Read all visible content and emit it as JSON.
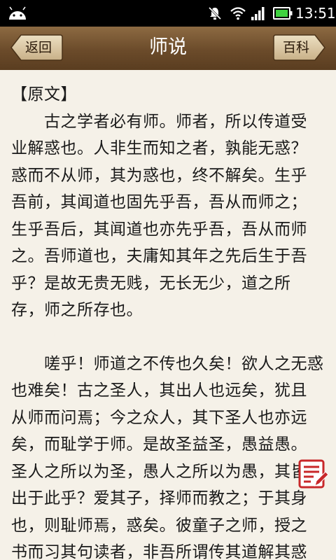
{
  "status_bar": {
    "time": "13:51"
  },
  "header": {
    "back_label": "返回",
    "title": "师说",
    "wiki_label": "百科"
  },
  "content": {
    "section_heading": "【原文】",
    "paragraph_1": [
      "　　古之学者必有师。师者，所以传道受",
      "业解惑也。人非生而知之者，孰能无惑？",
      "惑而不从师，其为惑也，终不解矣。生乎",
      "吾前，其闻道也固先乎吾，吾从而师之；",
      "生乎吾后，其闻道也亦先乎吾，吾从而师",
      "之。吾师道也，夫庸知其年之先后生于吾",
      "乎？是故无贵无贱，无长无少，道之所",
      "存，师之所存也。"
    ],
    "paragraph_2": [
      "　　嗟乎！师道之不传也久矣！欲人之无惑",
      "也难矣！古之圣人，其出人也远矣，犹且",
      "从师而问焉；今之众人，其下圣人也亦远",
      "矣，而耻学于师。是故圣益圣，愚益愚。",
      "圣人之所以为圣，愚人之所以为愚，其皆",
      "出于此乎？爱其子，择师而教之；于其身",
      "也，则耻师焉，惑矣。彼童子之师，授之",
      "书而习其句读者，非吾所谓传其道解其惑"
    ]
  },
  "colors": {
    "header_brown": "#6b4b2a",
    "page_background": "#f5f1e8",
    "note_icon_red": "#c8282a"
  }
}
